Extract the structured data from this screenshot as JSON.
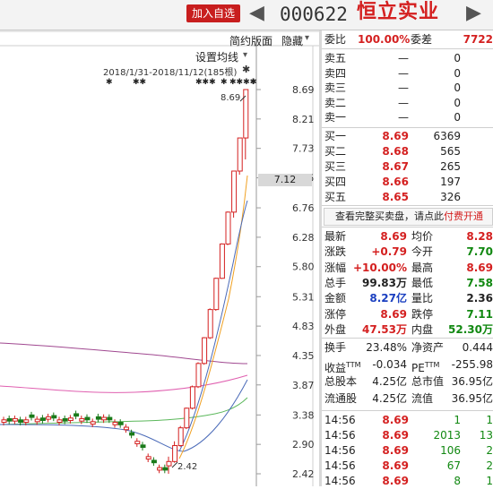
{
  "header": {
    "add_watch_label": "加入自选",
    "prev_icon": "◀",
    "next_icon": "▶",
    "stock_code": "000622",
    "stock_name": "恒立实业"
  },
  "chart": {
    "toolbar": {
      "simple_layout": "简约版面",
      "hide": "隐藏",
      "hide_glyph": "▾",
      "ma_settings": "设置均线",
      "ma_glyph": "▾",
      "date_range": "2018/1/31-2018/11/12(185根)",
      "pin_glyph": "✱"
    },
    "event_markers": [
      "✱",
      "✱✱",
      "✱✱✱",
      "✱",
      "✱✱✱✱",
      "✱"
    ],
    "high_label": "8.69",
    "low_label": "2.42",
    "current_price_tag": "7.12",
    "y_ticks": [
      "8.69",
      "8.21",
      "7.73",
      "7.25",
      "6.76",
      "6.28",
      "5.80",
      "5.31",
      "4.83",
      "4.35",
      "3.87",
      "3.38",
      "2.90",
      "2.42"
    ],
    "colors": {
      "up": "#d42020",
      "down": "#1a7a1a",
      "ma5": "#f0a020",
      "ma10": "#4a6ab8",
      "ma20": "#5cb85c",
      "ma60": "#e060b0",
      "ma120": "#a04890"
    }
  },
  "chart_data": {
    "type": "candlestick",
    "title": "",
    "ylim": [
      2.42,
      8.69
    ],
    "high": 8.69,
    "low": 2.42,
    "last_close": 8.69,
    "candles_recent": [
      {
        "o": 2.55,
        "h": 2.7,
        "l": 2.42,
        "c": 2.62
      },
      {
        "o": 2.62,
        "h": 2.95,
        "l": 2.6,
        "c": 2.88
      },
      {
        "o": 2.88,
        "h": 3.2,
        "l": 2.86,
        "c": 3.17
      },
      {
        "o": 3.17,
        "h": 3.5,
        "l": 3.15,
        "c": 3.49
      },
      {
        "o": 3.49,
        "h": 3.86,
        "l": 3.47,
        "c": 3.84
      },
      {
        "o": 3.84,
        "h": 4.24,
        "l": 3.82,
        "c": 4.22
      },
      {
        "o": 4.22,
        "h": 4.65,
        "l": 4.2,
        "c": 4.64
      },
      {
        "o": 4.64,
        "h": 5.12,
        "l": 4.62,
        "c": 5.1
      },
      {
        "o": 5.1,
        "h": 5.62,
        "l": 5.08,
        "c": 5.61
      },
      {
        "o": 5.61,
        "h": 6.18,
        "l": 5.6,
        "c": 6.17
      },
      {
        "o": 6.17,
        "h": 6.7,
        "l": 6.15,
        "c": 6.69
      },
      {
        "o": 6.69,
        "h": 7.36,
        "l": 6.6,
        "c": 7.36
      },
      {
        "o": 7.36,
        "h": 7.9,
        "l": 7.3,
        "c": 7.9
      },
      {
        "o": 7.9,
        "h": 8.69,
        "l": 7.55,
        "c": 8.69
      }
    ]
  },
  "quote": {
    "weibi_label": "委比",
    "weibi_value": "100.00%",
    "weicha_label": "委差",
    "weicha_value": "7722",
    "asks": [
      {
        "label": "卖五",
        "price": "—",
        "vol": "0"
      },
      {
        "label": "卖四",
        "price": "—",
        "vol": "0"
      },
      {
        "label": "卖三",
        "price": "—",
        "vol": "0"
      },
      {
        "label": "卖二",
        "price": "—",
        "vol": "0"
      },
      {
        "label": "卖一",
        "price": "—",
        "vol": "0"
      }
    ],
    "bids": [
      {
        "label": "买一",
        "price": "8.69",
        "vol": "6369"
      },
      {
        "label": "买二",
        "price": "8.68",
        "vol": "565"
      },
      {
        "label": "买三",
        "price": "8.67",
        "vol": "265"
      },
      {
        "label": "买四",
        "price": "8.66",
        "vol": "197"
      },
      {
        "label": "买五",
        "price": "8.65",
        "vol": "326"
      }
    ],
    "depth_text": "查看完整买卖盘，请点此",
    "depth_link": "付费开通",
    "stats_left": [
      {
        "label": "最新",
        "value": "8.69",
        "color": "red"
      },
      {
        "label": "涨跌",
        "value": "+0.79",
        "color": "red"
      },
      {
        "label": "涨幅",
        "value": "+10.00%",
        "color": "red"
      },
      {
        "label": "总手",
        "value": "99.83万",
        "color": "dark"
      },
      {
        "label": "金额",
        "value": "8.27亿",
        "color": "blue"
      },
      {
        "label": "涨停",
        "value": "8.69",
        "color": "red"
      },
      {
        "label": "外盘",
        "value": "47.53万",
        "color": "red"
      }
    ],
    "stats_right": [
      {
        "label": "均价",
        "value": "8.28",
        "color": "red"
      },
      {
        "label": "今开",
        "value": "7.70",
        "color": "green"
      },
      {
        "label": "最高",
        "value": "8.69",
        "color": "red"
      },
      {
        "label": "最低",
        "value": "7.58",
        "color": "green"
      },
      {
        "label": "量比",
        "value": "2.36",
        "color": "dark"
      },
      {
        "label": "跌停",
        "value": "7.11",
        "color": "green"
      },
      {
        "label": "内盘",
        "value": "52.30万",
        "color": "green"
      }
    ],
    "fund_left": [
      {
        "label": "换手",
        "value": "23.48%"
      },
      {
        "label": "收益",
        "sup": "TTM",
        "value": "-0.034"
      },
      {
        "label": "总股本",
        "value": "4.25亿"
      },
      {
        "label": "流通股",
        "value": "4.25亿"
      }
    ],
    "fund_right": [
      {
        "label": "净资产",
        "value": "0.444"
      },
      {
        "label": "PE",
        "sup": "TTM",
        "value": "-255.98"
      },
      {
        "label": "总市值",
        "value": "36.95亿"
      },
      {
        "label": "流值",
        "value": "36.95亿"
      }
    ],
    "ticks": [
      {
        "time": "14:56",
        "price": "8.69",
        "vol": "1",
        "extra": "1"
      },
      {
        "time": "14:56",
        "price": "8.69",
        "vol": "2013",
        "extra": "13"
      },
      {
        "time": "14:56",
        "price": "8.69",
        "vol": "106",
        "extra": "2"
      },
      {
        "time": "14:56",
        "price": "8.69",
        "vol": "67",
        "extra": "2"
      },
      {
        "time": "14:56",
        "price": "8.69",
        "vol": "8",
        "extra": "1"
      }
    ]
  }
}
